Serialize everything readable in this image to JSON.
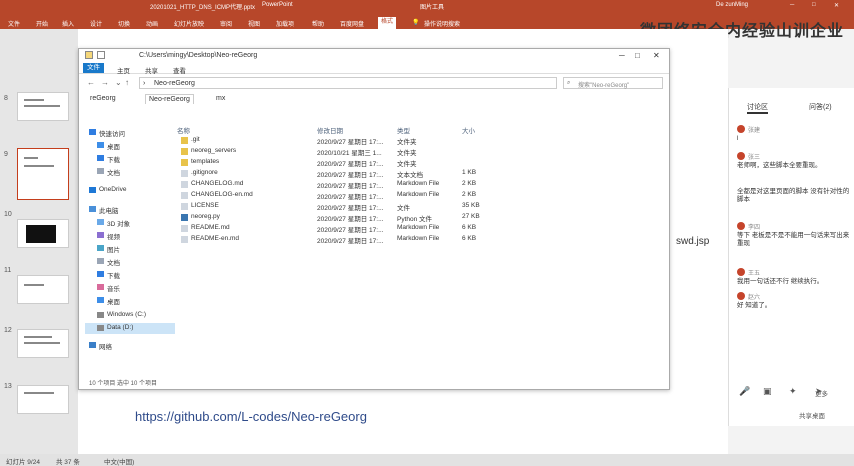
{
  "ppt": {
    "filename": "20201021_HTTP_DNS_ICMP代理.pptx",
    "app": "PowerPoint",
    "tools_label": "图片工具",
    "user": "De zunMing",
    "tabs": [
      "文件",
      "开始",
      "插入",
      "设计",
      "切换",
      "动画",
      "幻灯片放映",
      "审阅",
      "视图",
      "加载项",
      "帮助",
      "百度网盘",
      "格式"
    ],
    "tell_me": "操作说明搜索",
    "watermark": "微团络安全内经验山训企业"
  },
  "slides": {
    "numbers": [
      "8",
      "9",
      "10",
      "11",
      "12",
      "13"
    ]
  },
  "canvas": {
    "url": "https://github.com/L-codes/Neo-reGeorg",
    "side_text": "swd.jsp"
  },
  "explorer": {
    "title_path": "C:\\Users\\mingy\\Desktop\\Neo-reGeorg",
    "ribbon_tabs": [
      "文件",
      "主页",
      "共享",
      "查看"
    ],
    "address": "Neo-reGeorg",
    "search_placeholder": "搜索\"Neo-reGeorg\"",
    "folder_tabs": [
      "reGeorg",
      "Neo-reGeorg",
      "mx"
    ],
    "sidebar": [
      {
        "label": "快速访问",
        "icon": "star-icon"
      },
      {
        "label": "桌面",
        "icon": "desktop-icon"
      },
      {
        "label": "下载",
        "icon": "download-icon"
      },
      {
        "label": "文档",
        "icon": "document-icon"
      },
      {
        "label": "OneDrive",
        "icon": "cloud-icon"
      },
      {
        "label": "此电脑",
        "icon": "computer-icon"
      },
      {
        "label": "3D 对象",
        "icon": "cube-icon"
      },
      {
        "label": "视频",
        "icon": "video-icon"
      },
      {
        "label": "图片",
        "icon": "picture-icon"
      },
      {
        "label": "文档",
        "icon": "document-icon"
      },
      {
        "label": "下载",
        "icon": "download-icon"
      },
      {
        "label": "音乐",
        "icon": "music-icon"
      },
      {
        "label": "桌面",
        "icon": "desktop-icon"
      },
      {
        "label": "Windows (C:)",
        "icon": "drive-icon"
      },
      {
        "label": "Data (D:)",
        "icon": "drive-icon"
      },
      {
        "label": "网络",
        "icon": "network-icon"
      }
    ],
    "columns": [
      "名称",
      "修改日期",
      "类型",
      "大小"
    ],
    "files": [
      {
        "name": ".git",
        "date": "2020/9/27 星期日 17:...",
        "type": "文件夹",
        "size": "",
        "icon": "folder-icon"
      },
      {
        "name": "neoreg_servers",
        "date": "2020/10/21 星期三 1...",
        "type": "文件夹",
        "size": "",
        "icon": "folder-icon"
      },
      {
        "name": "templates",
        "date": "2020/9/27 星期日 17:...",
        "type": "文件夹",
        "size": "",
        "icon": "folder-icon"
      },
      {
        "name": ".gitignore",
        "date": "2020/9/27 星期日 17:...",
        "type": "文本文档",
        "size": "1 KB",
        "icon": "file-icon"
      },
      {
        "name": "CHANGELOG.md",
        "date": "2020/9/27 星期日 17:...",
        "type": "Markdown File",
        "size": "2 KB",
        "icon": "file-icon"
      },
      {
        "name": "CHANGELOG-en.md",
        "date": "2020/9/27 星期日 17:...",
        "type": "Markdown File",
        "size": "2 KB",
        "icon": "file-icon"
      },
      {
        "name": "LICENSE",
        "date": "2020/9/27 星期日 17:...",
        "type": "文件",
        "size": "35 KB",
        "icon": "file-icon"
      },
      {
        "name": "neoreg.py",
        "date": "2020/9/27 星期日 17:...",
        "type": "Python 文件",
        "size": "27 KB",
        "icon": "python-icon"
      },
      {
        "name": "README.md",
        "date": "2020/9/27 星期日 17:...",
        "type": "Markdown File",
        "size": "6 KB",
        "icon": "file-icon"
      },
      {
        "name": "README-en.md",
        "date": "2020/9/27 星期日 17:...",
        "type": "Markdown File",
        "size": "6 KB",
        "icon": "file-icon"
      }
    ],
    "status": "10 个项目  选中 10 个项目"
  },
  "chat": {
    "tabs": [
      "讨论区",
      "问答(2)"
    ],
    "messages": [
      {
        "who": "张建",
        "text": "l"
      },
      {
        "who": "张三",
        "text": "老师啊，这些脚本全要重现。"
      },
      {
        "who": "",
        "text": "全都是对这里页面的脚本 没有针对性的脚本"
      },
      {
        "who": "李四",
        "text": "等下 老板是不是不能用一句话来写出来重现"
      },
      {
        "who": "王五",
        "text": "我用一句话还不行 继续执行。"
      },
      {
        "who": "赵六",
        "text": "好 知道了。"
      }
    ],
    "more": "更多",
    "footer": "共享桌面"
  },
  "statusbar": {
    "slide_info": "幻灯片 9/24",
    "count": "共 37 条",
    "lang": "中文(中国)"
  }
}
